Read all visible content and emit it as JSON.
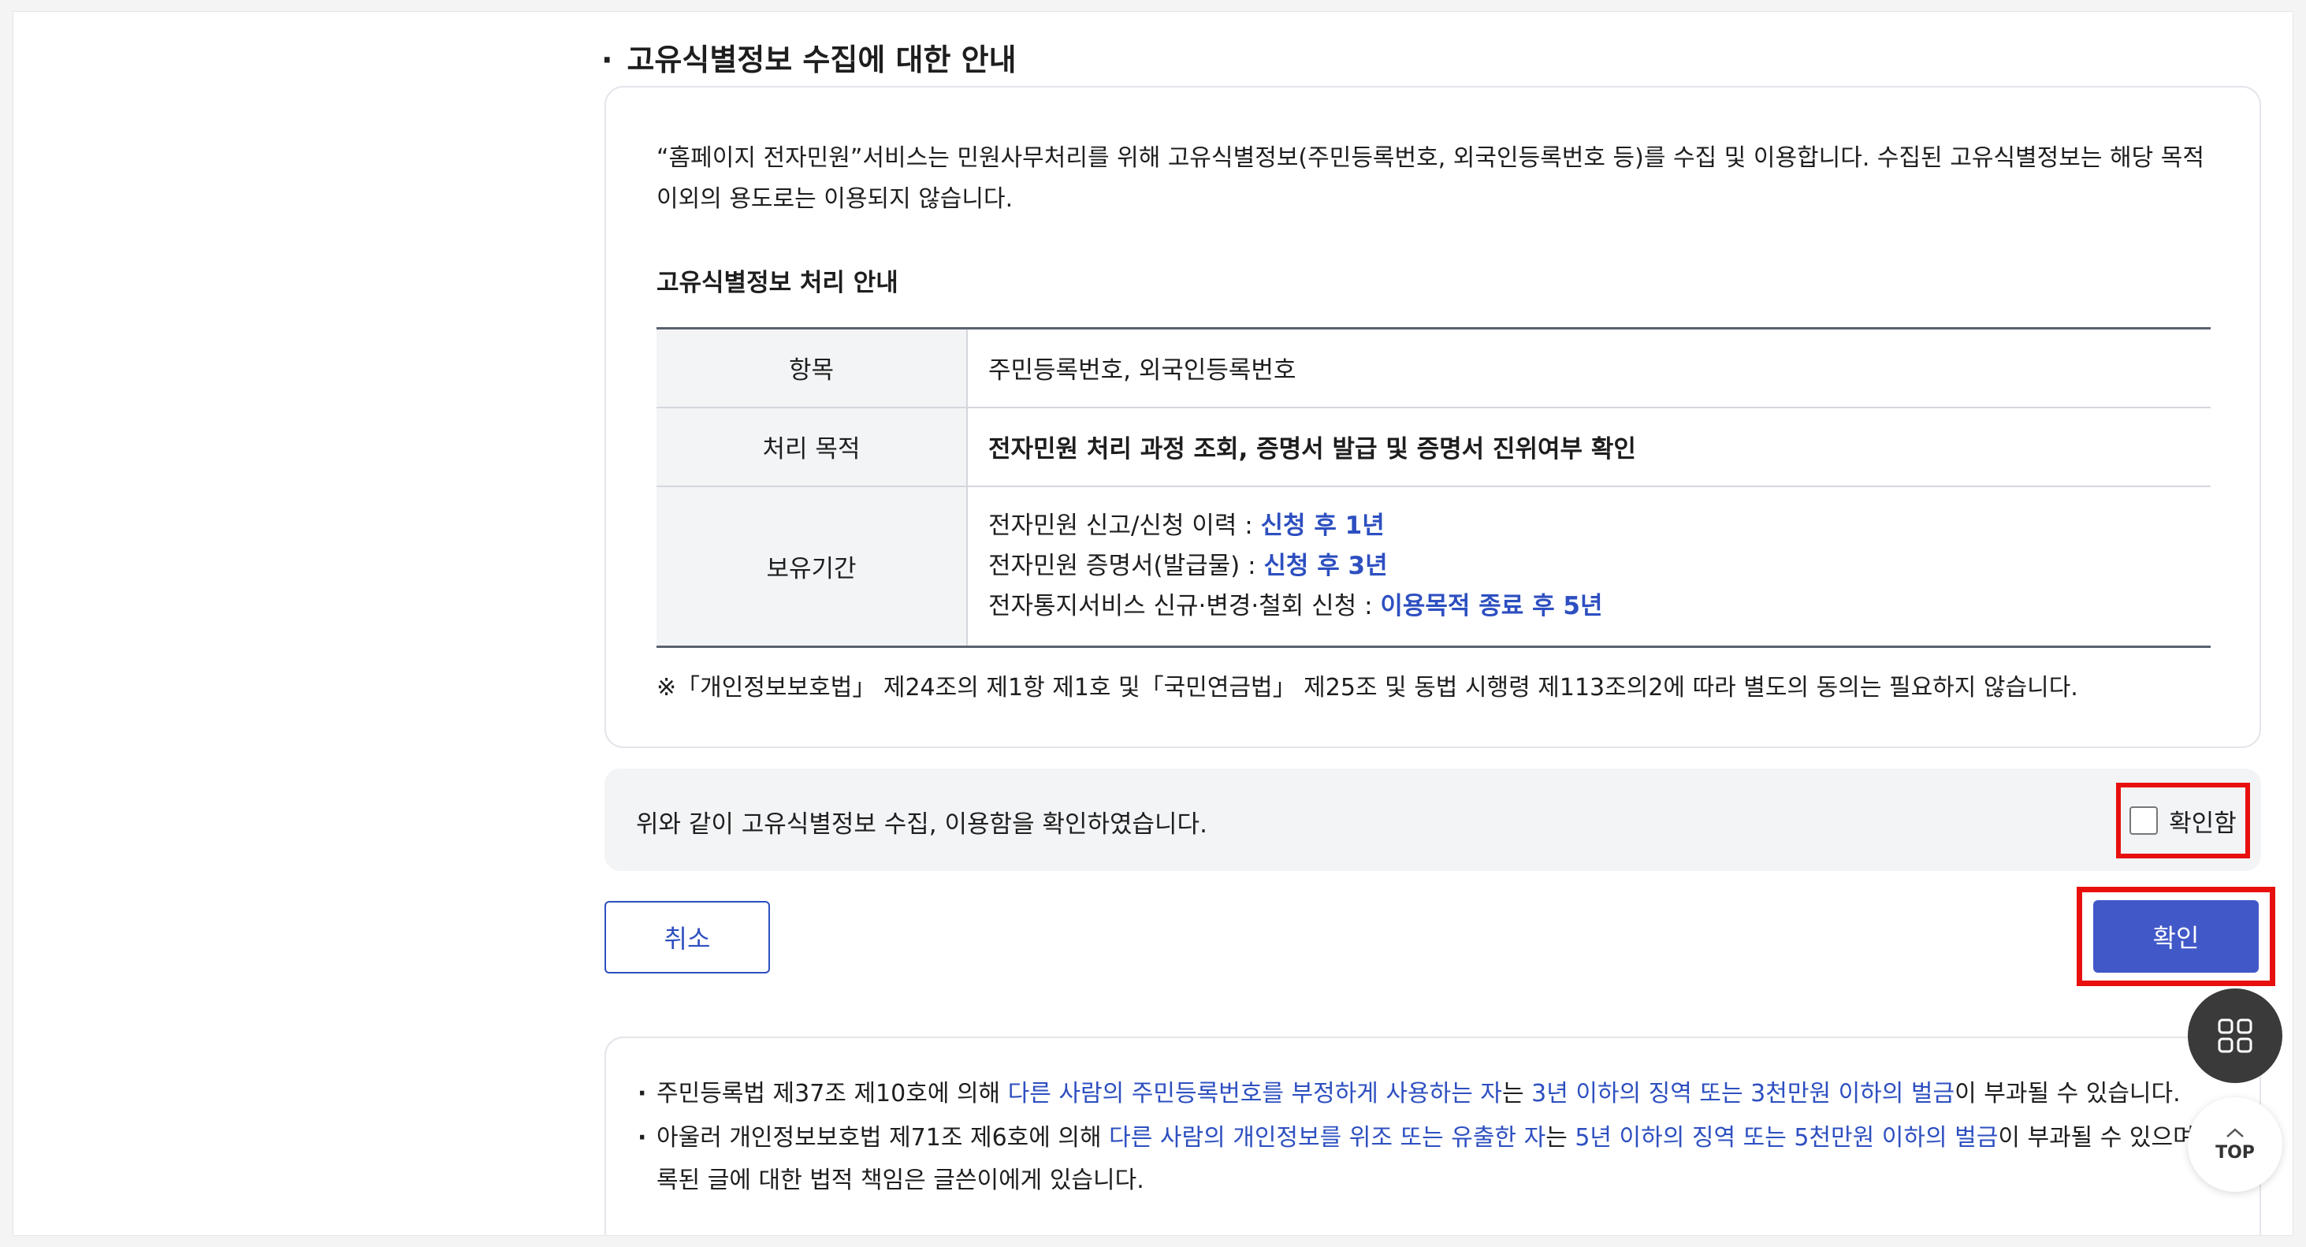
{
  "section": {
    "bullet": "·",
    "title": "고유식별정보 수집에 대한 안내"
  },
  "intro": {
    "text": "“홈페이지 전자민원”서비스는 민원사무처리를 위해 고유식별정보(주민등록번호, 외국인등록번호 등)를 수집 및 이용합니다. 수집된 고유식별정보는 해당 목적이외의 용도로는 이용되지 않습니다."
  },
  "processing": {
    "title": "고유식별정보 처리 안내",
    "item_label": "항목",
    "item_value": "주민등록번호, 외국인등록번호",
    "purpose_label": "처리 목적",
    "purpose_value": "전자민원 처리 과정 조회, 증명서 발급 및 증명서 진위여부 확인",
    "retention_label": "보유기간",
    "retention": [
      {
        "prefix": "전자민원 신고/신청 이력 : ",
        "value": "신청 후 1년"
      },
      {
        "prefix": "전자민원 증명서(발급물) : ",
        "value": "신청 후 3년"
      },
      {
        "prefix": "전자통지서비스 신규·변경·철회 신청 : ",
        "value": "이용목적 종료 후 5년"
      }
    ]
  },
  "legal_note": "※「개인정보보호법」 제24조의 제1항 제1호 및「국민연금법」 제25조 및 동법 시행령 제113조의2에 따라 별도의 동의는 필요하지 않습니다.",
  "confirm": {
    "statement": "위와 같이 고유식별정보 수집, 이용함을 확인하였습니다.",
    "checkbox_label": "확인함"
  },
  "buttons": {
    "cancel": "취소",
    "confirm": "확인"
  },
  "notices": [
    {
      "parts": [
        {
          "t": "주민등록법 제37조 제10호에 의해 ",
          "c": ""
        },
        {
          "t": "다른 사람의 주민등록번호를 부정하게 사용하는 자",
          "c": "blue"
        },
        {
          "t": "는 ",
          "c": ""
        },
        {
          "t": "3년 이하의 징역 또는 3천만원 이하의 벌금",
          "c": "blue"
        },
        {
          "t": "이 부과될 수 있습니다.",
          "c": ""
        }
      ]
    },
    {
      "parts": [
        {
          "t": "아울러 개인정보보호법 제71조 제6호에 의해 ",
          "c": ""
        },
        {
          "t": "다른 사람의 개인정보를 위조 또는 유출한 자",
          "c": "blue"
        },
        {
          "t": "는 ",
          "c": ""
        },
        {
          "t": "5년 이하의 징역 또는 5천만원 이하의 벌금",
          "c": "blue"
        },
        {
          "t": "이 부과될 수 있으며, 등록된 글에 대한 법적 책임은 글쓴이에게 있습니다.",
          "c": ""
        }
      ]
    }
  ],
  "fab": {
    "menu_icon": "grid-icon",
    "top_label": "TOP"
  },
  "colors": {
    "accent": "#4158c8",
    "link_blue": "#2d4fc0",
    "highlight_red": "#e8100f"
  }
}
